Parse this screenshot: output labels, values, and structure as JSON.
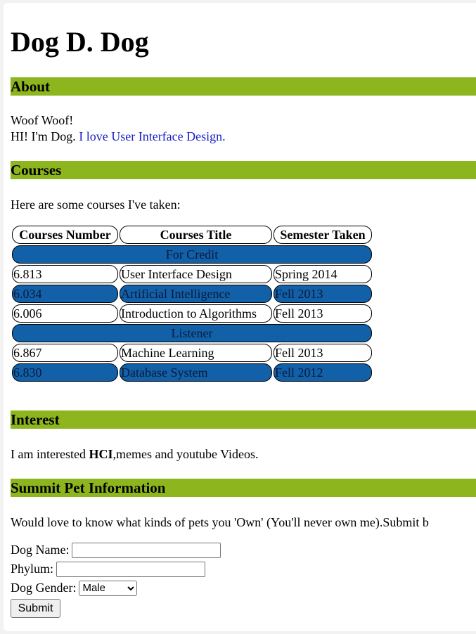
{
  "name": "Dog D. Dog",
  "about": {
    "heading": "About",
    "line1": "Woof Woof!",
    "line2_prefix": "HI! I'm Dog. ",
    "line2_link": "I love User Interface Design."
  },
  "courses": {
    "heading": "Courses",
    "intro": "Here are some courses I've taken:",
    "headers": [
      "Courses Number",
      "Courses Title",
      "Semester Taken"
    ],
    "group_credit": "For Credit",
    "group_listener": "Listener",
    "credit_rows": [
      [
        "6.813",
        "User Interface Design",
        "Spring 2014"
      ],
      [
        "6.034",
        "Artificial Intelligence",
        "Fell 2013"
      ],
      [
        "6.006",
        "Introduction to Algorithms",
        "Fell 2013"
      ]
    ],
    "listener_rows": [
      [
        "6.867",
        "Machine Learning",
        "Fell 2013"
      ],
      [
        "6.830",
        "Database System",
        "Fell 2012"
      ]
    ]
  },
  "interest": {
    "heading": "Interest",
    "prefix": "I am interested ",
    "bold": "HCI",
    "suffix": ",memes and youtube Videos."
  },
  "pet_form": {
    "heading": "Summit Pet Information",
    "intro": "Would love to know what kinds of pets you 'Own' (You'll never own me).Submit b",
    "dog_name_label": "Dog Name:",
    "dog_name_value": "",
    "phylum_label": "Phylum:",
    "phylum_value": "",
    "gender_label": "Dog Gender:",
    "gender_selected": "Male",
    "submit_label": "Submit"
  },
  "colors": {
    "section_bar": "#8db51e",
    "row_highlight": "#1260a8",
    "link": "#1a22c8"
  }
}
